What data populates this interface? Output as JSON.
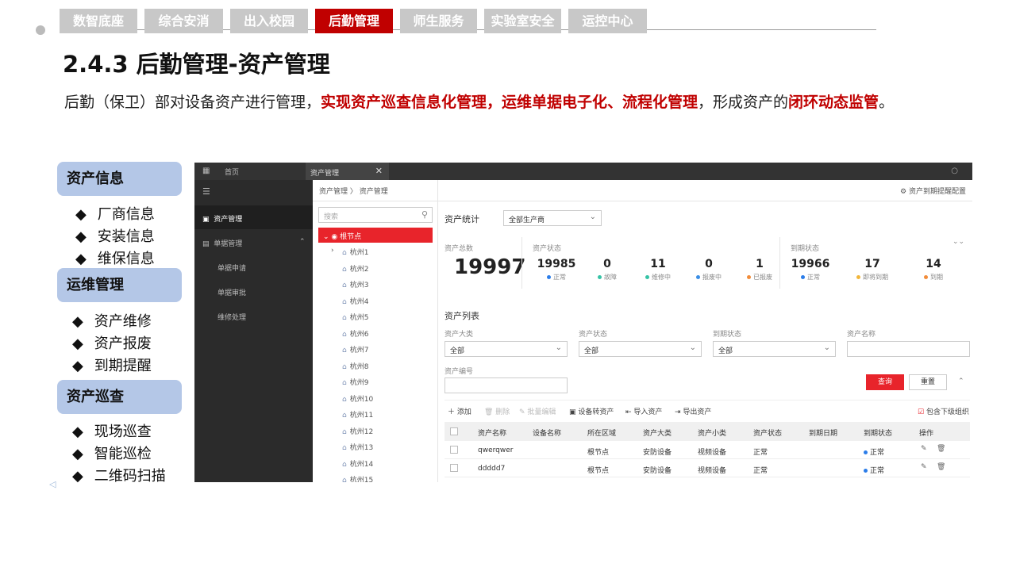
{
  "nav_tabs": [
    {
      "label": "数智底座",
      "active": false
    },
    {
      "label": "综合安消",
      "active": false
    },
    {
      "label": "出入校园",
      "active": false
    },
    {
      "label": "后勤管理",
      "active": true
    },
    {
      "label": "师生服务",
      "active": false
    },
    {
      "label": "实验室安全",
      "active": false
    },
    {
      "label": "运控中心",
      "active": false
    }
  ],
  "title": "2.4.3 后勤管理-资产管理",
  "description": {
    "p1": "后勤（保卫）部对设备资产进行管理，",
    "h1": "实现资产巡查信息化管理，运维单据电子化、流程化管理",
    "p2": "，形成资产的",
    "h2": "闭环动态监管",
    "p3": "。"
  },
  "left_panel": {
    "sections": [
      {
        "title": "资产信息",
        "items": [
          "厂商信息",
          "安装信息",
          "维保信息"
        ]
      },
      {
        "title": "运维管理",
        "items": [
          "资产维修",
          "资产报废",
          "到期提醒"
        ]
      },
      {
        "title": "资产巡查",
        "items": [
          "现场巡查",
          "智能巡检",
          "二维码扫描"
        ]
      }
    ],
    "bullet": "◆"
  },
  "app": {
    "tabs": {
      "home": "首页",
      "active": "资产管理"
    },
    "sidebar": {
      "asset_mgmt": "资产管理",
      "doc_mgmt": "单据管理",
      "sub": [
        "单据申请",
        "单据审批",
        "维修处理"
      ]
    },
    "breadcrumb": "资产管理 〉 资产管理",
    "config_link": "资产到期提醒配置",
    "tree": {
      "search_placeholder": "搜索",
      "root": "根节点",
      "nodes": [
        "杭州1",
        "杭州2",
        "杭州3",
        "杭州4",
        "杭州5",
        "杭州6",
        "杭州7",
        "杭州8",
        "杭州9",
        "杭州10",
        "杭州11",
        "杭州12",
        "杭州13",
        "杭州14",
        "杭州15"
      ]
    },
    "stats": {
      "heading": "资产统计",
      "manufacturer_select": "全部生产商",
      "total_label": "资产总数",
      "total": "19997",
      "status_label": "资产状态",
      "expiry_label": "到期状态",
      "status": [
        {
          "value": "19985",
          "label": "正常",
          "color": "#2b7de9"
        },
        {
          "value": "0",
          "label": "故障",
          "color": "#35c3a5"
        },
        {
          "value": "11",
          "label": "维修中",
          "color": "#35c3a5"
        },
        {
          "value": "0",
          "label": "报废中",
          "color": "#3a8ee6"
        },
        {
          "value": "1",
          "label": "已报废",
          "color": "#f28c3a"
        }
      ],
      "expiry": [
        {
          "value": "19966",
          "label": "正常",
          "color": "#2b7de9"
        },
        {
          "value": "17",
          "label": "即将到期",
          "color": "#f2b63a"
        },
        {
          "value": "14",
          "label": "到期",
          "color": "#f28c3a"
        }
      ]
    },
    "list": {
      "heading": "资产列表",
      "filters": {
        "category_label": "资产大类",
        "category_value": "全部",
        "status_label": "资产状态",
        "status_value": "全部",
        "expiry_label": "到期状态",
        "expiry_value": "全部",
        "name_label": "资产名称",
        "code_label": "资产编号"
      },
      "query_btn": "查询",
      "reset_btn": "重置",
      "toolbar": [
        "添加",
        "删除",
        "批量编辑",
        "设备转资产",
        "导入资产",
        "导出资产"
      ],
      "include_sub": "包含下级组织",
      "columns": [
        "资产名称",
        "设备名称",
        "所在区域",
        "资产大类",
        "资产小类",
        "资产状态",
        "到期日期",
        "到期状态",
        "操作"
      ],
      "rows": [
        [
          "qwerqwer",
          "",
          "根节点",
          "安防设备",
          "视频设备",
          "正常",
          "",
          "正常"
        ],
        [
          "ddddd7",
          "",
          "根节点",
          "安防设备",
          "视频设备",
          "正常",
          "",
          "正常"
        ]
      ]
    }
  }
}
